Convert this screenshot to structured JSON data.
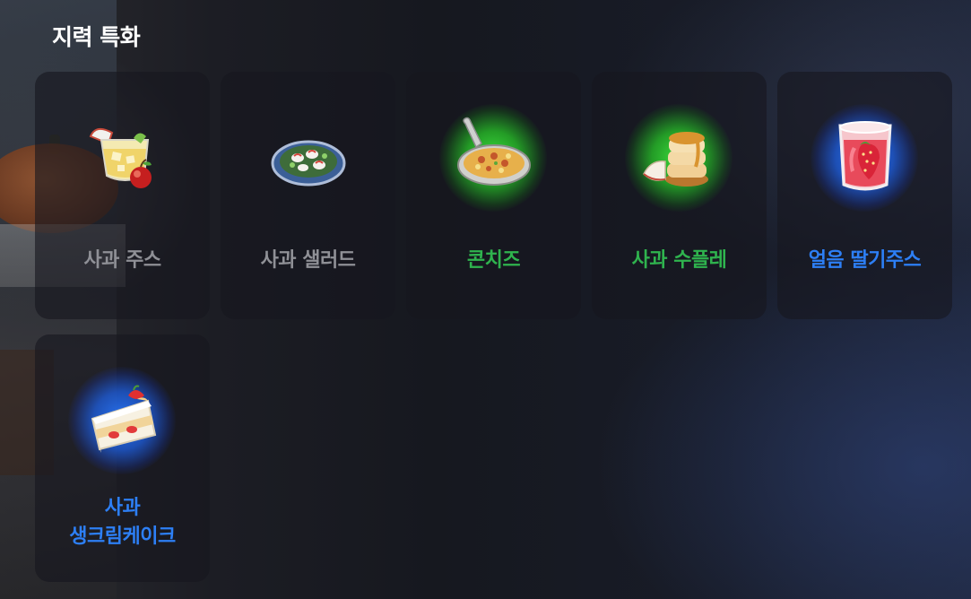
{
  "section_title": "지력 특화",
  "items": [
    {
      "label": "사과 주스",
      "label_color": "#8f9096",
      "glow": "none",
      "icon": "apple-juice-icon"
    },
    {
      "label": "사과 샐러드",
      "label_color": "#8f9096",
      "glow": "none",
      "icon": "apple-salad-icon"
    },
    {
      "label": "콘치즈",
      "label_color": "#2fb34e",
      "glow": "green",
      "icon": "corn-cheese-icon"
    },
    {
      "label": "사과 수플레",
      "label_color": "#2fb34e",
      "glow": "green",
      "icon": "apple-souffle-icon"
    },
    {
      "label": "얼음 딸기주스",
      "label_color": "#2d7ff5",
      "glow": "blue",
      "icon": "iced-strawberry-juice-icon"
    },
    {
      "label_line1": "사과",
      "label_line2": "생크림케이크",
      "label_color": "#2d7ff5",
      "glow": "blue",
      "icon": "apple-cream-cake-icon"
    }
  ]
}
